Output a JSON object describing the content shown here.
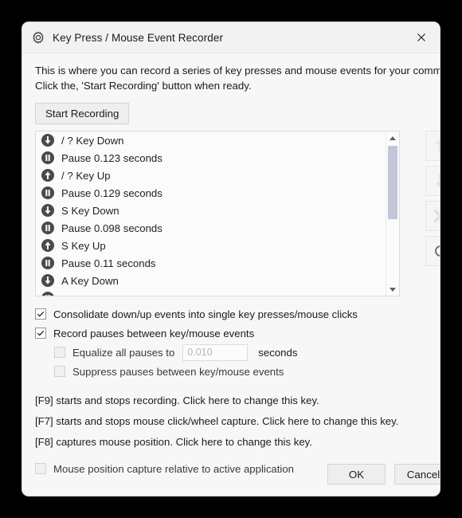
{
  "window": {
    "title": "Key Press / Mouse Event Recorder",
    "icon": "gear-icon",
    "close_label": "×"
  },
  "intro": {
    "line1": "This is where you can record a series of key presses and mouse events for your command.",
    "line2": "Click the, 'Start Recording' button when ready."
  },
  "toolbar": {
    "start_recording_label": "Start Recording"
  },
  "event_list": [
    {
      "icon": "key-down-icon",
      "label": "/ ? Key Down"
    },
    {
      "icon": "pause-icon",
      "label": "Pause 0.123 seconds"
    },
    {
      "icon": "key-up-icon",
      "label": "/ ? Key Up"
    },
    {
      "icon": "pause-icon",
      "label": "Pause 0.129 seconds"
    },
    {
      "icon": "key-down-icon",
      "label": "S Key Down"
    },
    {
      "icon": "pause-icon",
      "label": "Pause 0.098 seconds"
    },
    {
      "icon": "key-up-icon",
      "label": "S Key Up"
    },
    {
      "icon": "pause-icon",
      "label": "Pause 0.11 seconds"
    },
    {
      "icon": "key-down-icon",
      "label": "A Key Down"
    },
    {
      "icon": "pause-icon",
      "label": ""
    }
  ],
  "side_tools": [
    {
      "name": "move-up-button",
      "icon": "arrow-up-icon",
      "enabled": false
    },
    {
      "name": "move-down-button",
      "icon": "arrow-down-icon",
      "enabled": false
    },
    {
      "name": "delete-button",
      "icon": "x-icon",
      "enabled": false
    },
    {
      "name": "reset-button",
      "icon": "refresh-icon",
      "enabled": true
    }
  ],
  "options": {
    "consolidate": {
      "label": "Consolidate down/up events into single key presses/mouse clicks",
      "checked": true
    },
    "record_pauses": {
      "label": "Record pauses between key/mouse events",
      "checked": true
    },
    "equalize": {
      "label": "Equalize all pauses to",
      "checked": false,
      "value": "",
      "placeholder": "0.010",
      "unit": "seconds"
    },
    "suppress": {
      "label": "Suppress pauses between key/mouse events",
      "checked": false
    },
    "relative_capture": {
      "label": "Mouse position capture relative to active application",
      "checked": false
    }
  },
  "hotkeys": [
    "[F9] starts and stops recording.  Click here to change this key.",
    "[F7] starts and stops mouse click/wheel capture.  Click here to change this key.",
    "[F8] captures mouse position.  Click here to change this key."
  ],
  "footer": {
    "ok_label": "OK",
    "cancel_label": "Cancel"
  },
  "colors": {
    "dialog_bg": "#f7f7f7",
    "titlebar_bg": "#f2f2f2",
    "scroll_thumb": "#c3c6d8",
    "icon_dark": "#4a4a4a",
    "icon_disabled": "#e0e0e2"
  }
}
